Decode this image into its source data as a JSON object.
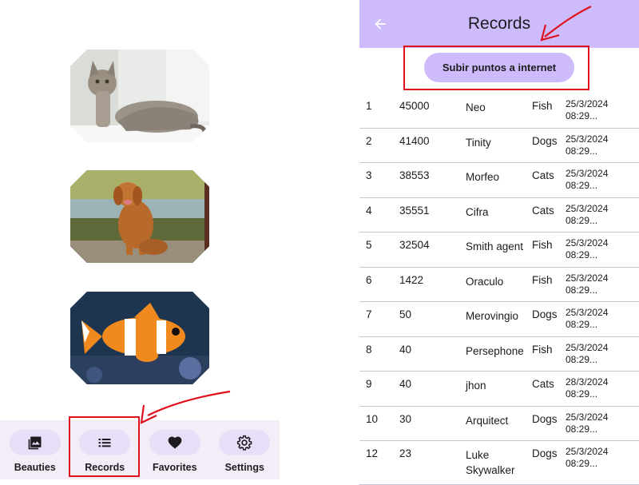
{
  "left_screen": {
    "images": [
      {
        "alt": "cat",
        "icon": "cat-photo"
      },
      {
        "alt": "dog",
        "icon": "dog-photo"
      },
      {
        "alt": "clownfish",
        "icon": "fish-photo"
      }
    ],
    "bottom_nav": [
      {
        "label": "Beauties",
        "icon": "photo-library-icon"
      },
      {
        "label": "Records",
        "icon": "list-icon"
      },
      {
        "label": "Favorites",
        "icon": "heart-icon"
      },
      {
        "label": "Settings",
        "icon": "gear-icon"
      }
    ]
  },
  "right_screen": {
    "title": "Records",
    "back_icon": "arrow-back-icon",
    "upload_button": "Subir puntos a internet",
    "rows": [
      {
        "rank": "1",
        "score": "45000",
        "name": "Neo",
        "category": "Fish",
        "date": "25/3/2024 08:29..."
      },
      {
        "rank": "2",
        "score": "41400",
        "name": "Tinity",
        "category": "Dogs",
        "date": "25/3/2024 08:29..."
      },
      {
        "rank": "3",
        "score": "38553",
        "name": "Morfeo",
        "category": "Cats",
        "date": "25/3/2024 08:29..."
      },
      {
        "rank": "4",
        "score": "35551",
        "name": "Cifra",
        "category": "Cats",
        "date": "25/3/2024 08:29..."
      },
      {
        "rank": "5",
        "score": "32504",
        "name": "Smith agent",
        "category": "Fish",
        "date": "25/3/2024 08:29..."
      },
      {
        "rank": "6",
        "score": "1422",
        "name": "Oraculo",
        "category": "Fish",
        "date": "25/3/2024 08:29..."
      },
      {
        "rank": "7",
        "score": "50",
        "name": "Merovingio",
        "category": "Dogs",
        "date": "25/3/2024 08:29..."
      },
      {
        "rank": "8",
        "score": "40",
        "name": "Persephone",
        "category": "Fish",
        "date": "25/3/2024 08:29..."
      },
      {
        "rank": "9",
        "score": "40",
        "name": "jhon",
        "category": "Cats",
        "date": "28/3/2024 08:29..."
      },
      {
        "rank": "10",
        "score": "30",
        "name": "Arquitect",
        "category": "Dogs",
        "date": "25/3/2024 08:29..."
      },
      {
        "rank": "12",
        "score": "23",
        "name": "Luke Skywalker",
        "category": "Dogs",
        "date": "25/3/2024 08:29..."
      }
    ]
  },
  "colors": {
    "accent": "#cebbfc",
    "nav_background": "#f3edf7",
    "nav_pill": "#e8def8",
    "annotation": "#e0101c"
  }
}
